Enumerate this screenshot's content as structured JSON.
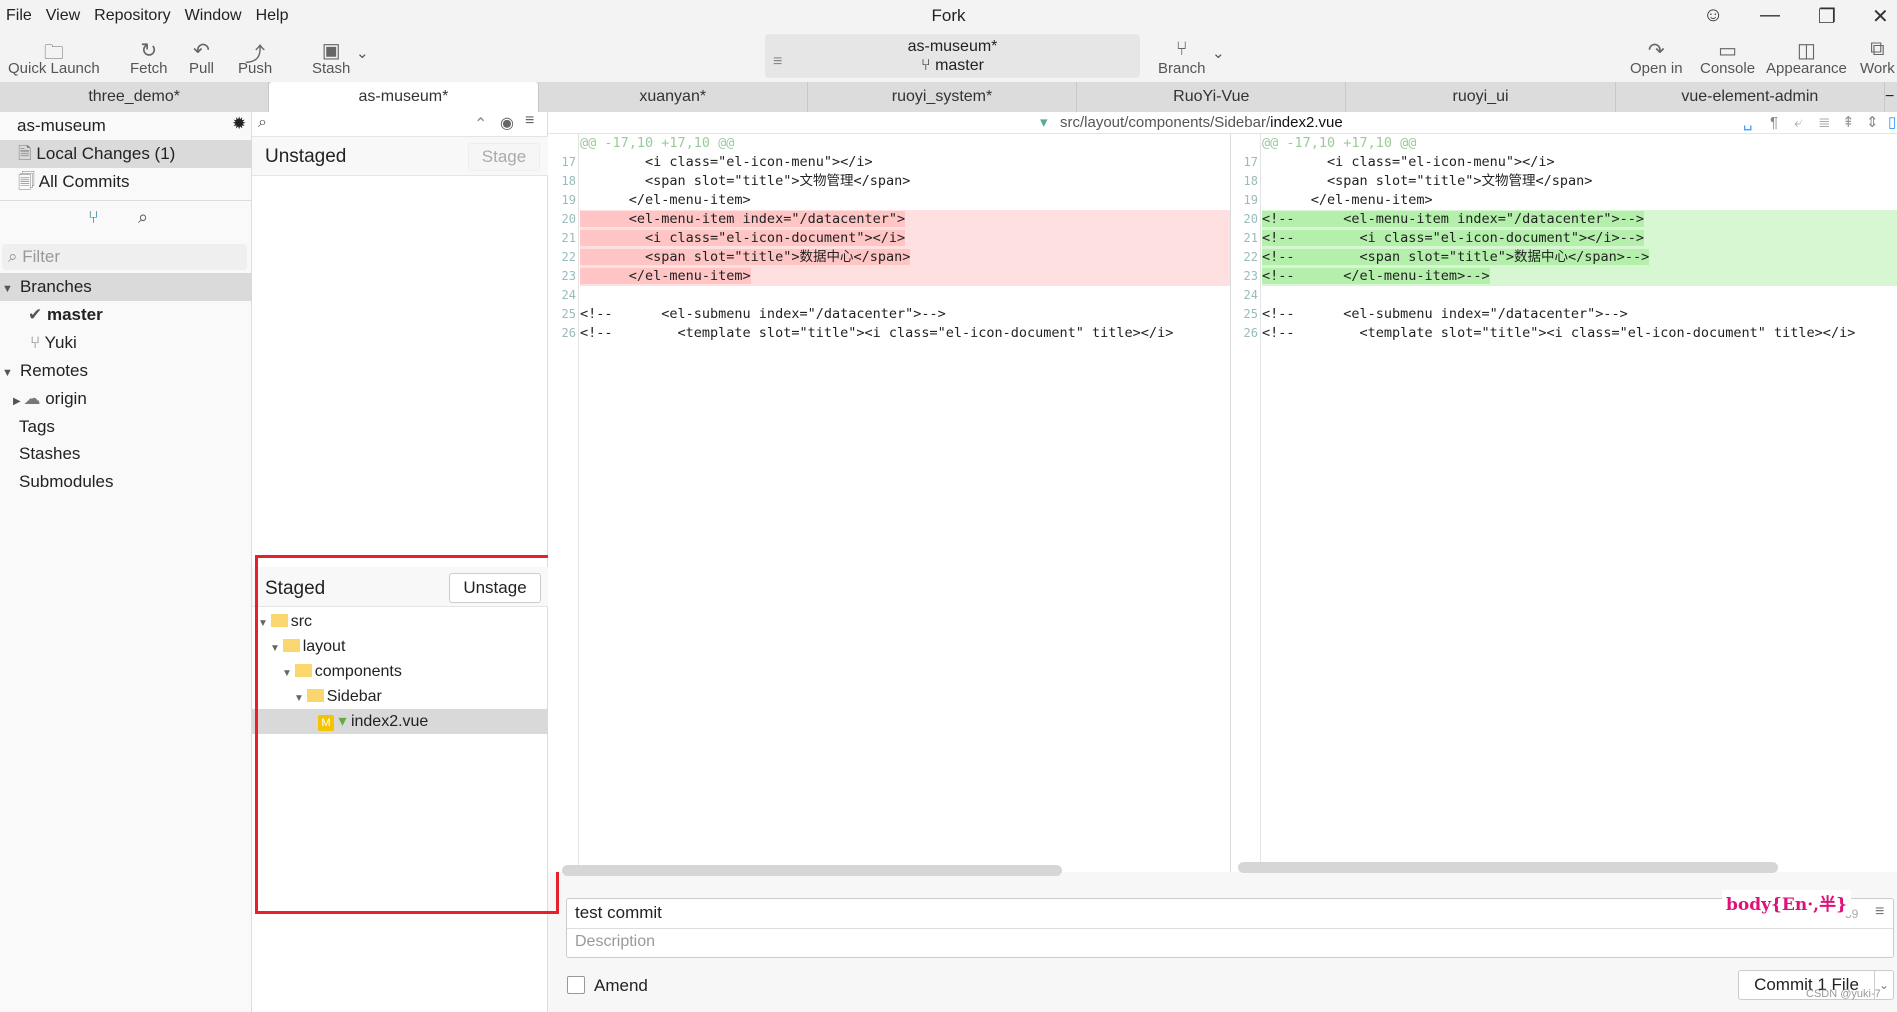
{
  "menu": [
    "File",
    "View",
    "Repository",
    "Window",
    "Help"
  ],
  "app_title": "Fork",
  "toolbar": {
    "quick_launch": "Quick Launch",
    "fetch": "Fetch",
    "pull": "Pull",
    "push": "Push",
    "stash": "Stash",
    "branch": "Branch",
    "open_in": "Open in",
    "console": "Console",
    "appearance": "Appearance",
    "work": "Work"
  },
  "repo": {
    "name": "as-museum*",
    "branch": "master"
  },
  "tabs": [
    "three_demo*",
    "as-museum*",
    "xuanyan*",
    "ruoyi_system*",
    "RuoYi-Vue",
    "ruoyi_ui",
    "vue-element-admin"
  ],
  "sidebar": {
    "repo": "as-museum",
    "local_changes": "Local Changes (1)",
    "all_commits": "All Commits",
    "filter_placeholder": "Filter",
    "branches": "Branches",
    "branch_items": [
      "master",
      "Yuki"
    ],
    "remotes": "Remotes",
    "origin": "origin",
    "tags": "Tags",
    "stashes": "Stashes",
    "submodules": "Submodules"
  },
  "unstaged": {
    "title": "Unstaged",
    "button": "Stage"
  },
  "staged": {
    "title": "Staged",
    "button": "Unstage",
    "tree": [
      "src",
      "layout",
      "components",
      "Sidebar",
      "index2.vue"
    ],
    "badge": "M"
  },
  "diff": {
    "path_dir": "src/layout/components/Sidebar/",
    "path_file": "index2.vue",
    "hunk": "@@ -17,10 +17,10 @@",
    "left": [
      {
        "n": "17",
        "t": "        <i class=\"el-icon-menu\"></i>",
        "k": ""
      },
      {
        "n": "18",
        "t": "        <span slot=\"title\">文物管理</span>",
        "k": ""
      },
      {
        "n": "19",
        "t": "      </el-menu-item>",
        "k": ""
      },
      {
        "n": "20",
        "t": "      <el-menu-item index=\"/datacenter\">",
        "k": "del"
      },
      {
        "n": "21",
        "t": "        <i class=\"el-icon-document\"></i>",
        "k": "del"
      },
      {
        "n": "22",
        "t": "        <span slot=\"title\">数据中心</span>",
        "k": "del"
      },
      {
        "n": "23",
        "t": "      </el-menu-item>",
        "k": "del"
      },
      {
        "n": "24",
        "t": "",
        "k": ""
      },
      {
        "n": "25",
        "t": "<!--      <el-submenu index=\"/datacenter\">-->",
        "k": ""
      },
      {
        "n": "26",
        "t": "<!--        <template slot=\"title\"><i class=\"el-icon-document\" title></i>",
        "k": ""
      }
    ],
    "right": [
      {
        "n": "17",
        "t": "        <i class=\"el-icon-menu\"></i>",
        "k": ""
      },
      {
        "n": "18",
        "t": "        <span slot=\"title\">文物管理</span>",
        "k": ""
      },
      {
        "n": "19",
        "t": "      </el-menu-item>",
        "k": ""
      },
      {
        "n": "20",
        "t": "<!--      <el-menu-item index=\"/datacenter\">-->",
        "k": "add"
      },
      {
        "n": "21",
        "t": "<!--        <i class=\"el-icon-document\"></i>-->",
        "k": "add"
      },
      {
        "n": "22",
        "t": "<!--        <span slot=\"title\">数据中心</span>-->",
        "k": "add"
      },
      {
        "n": "23",
        "t": "<!--      </el-menu-item>-->",
        "k": "add"
      },
      {
        "n": "24",
        "t": "",
        "k": ""
      },
      {
        "n": "25",
        "t": "<!--      <el-submenu index=\"/datacenter\">-->",
        "k": ""
      },
      {
        "n": "26",
        "t": "<!--        <template slot=\"title\"><i class=\"el-icon-document\" title></i>",
        "k": ""
      }
    ]
  },
  "commit": {
    "message": "test commit",
    "description_placeholder": "Description",
    "char_count": "59",
    "amend": "Amend",
    "button": "Commit 1 File",
    "ime": "body{En·,半}",
    "watermark": "CSDN @yuki-7"
  },
  "colors": {
    "highlight_box": "#e8202a",
    "deleted": "#ffe0e0",
    "added": "#d7f7d3",
    "folder": "#f9d66e"
  }
}
